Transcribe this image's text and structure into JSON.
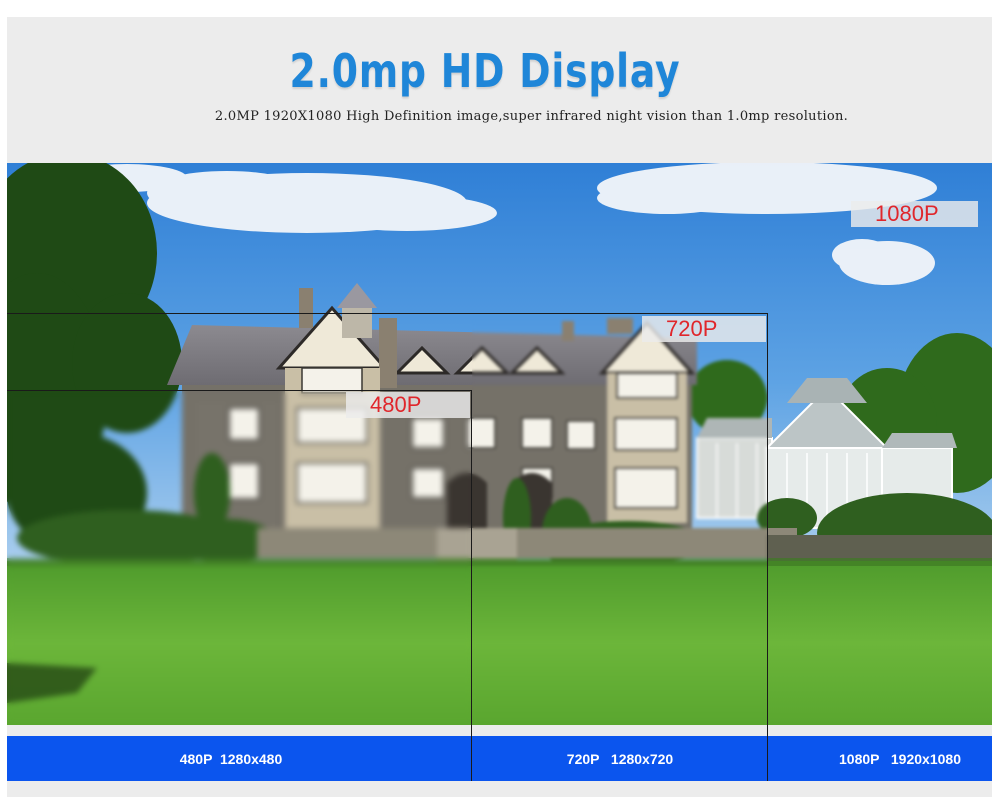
{
  "header": {
    "title": "2.0mp HD Display",
    "subtitle": "2.0MP 1920X1080 High Definition image,super infrared night vision than 1.0mp resolution."
  },
  "overlay_labels": {
    "p1080": "1080P",
    "p720": "720P",
    "p480": "480P"
  },
  "resolution_bar": {
    "r480": "480P  1280x480",
    "r720": "720P   1280x720",
    "r1080": "1080P   1920x1080"
  },
  "colors": {
    "title_blue": "#1f86d8",
    "label_red": "#e0262b",
    "bar_blue": "#0b55ee"
  }
}
